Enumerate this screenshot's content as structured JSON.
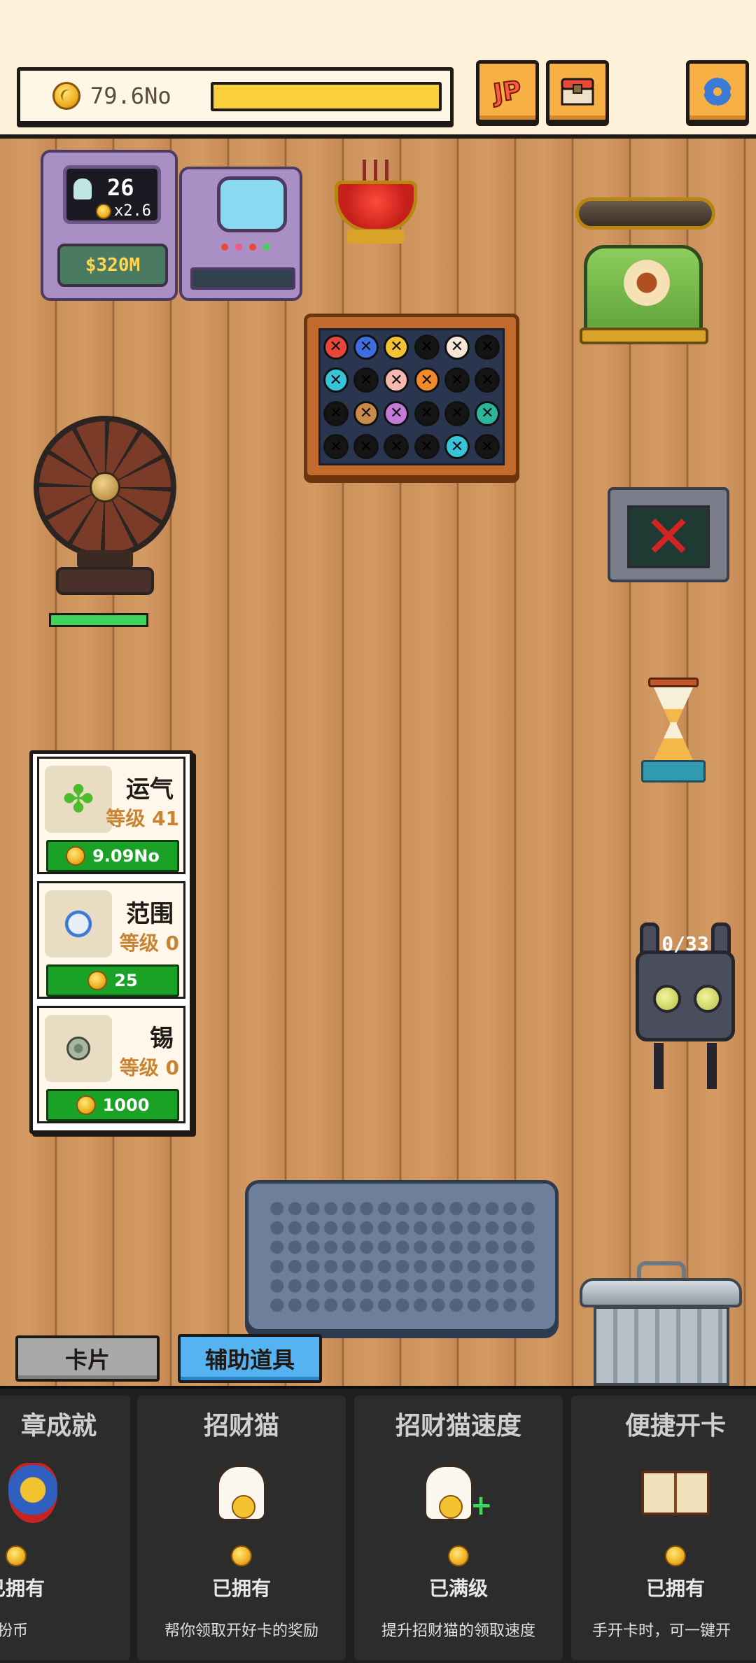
{
  "top_bar": {
    "coins": "79.6No",
    "progress": 1.0,
    "jackpot_label": "JP",
    "buttons": [
      "jackpot-icon",
      "shop-chest-icon",
      "gear-icon"
    ]
  },
  "score_machine": {
    "count": "26",
    "multiplier": "x2.6",
    "money": "$320M"
  },
  "fan": {
    "health": 1.0
  },
  "robot": {
    "counter": "0/33"
  },
  "upgrades": [
    {
      "name": "运气",
      "level": "等级 41",
      "cost": "9.09No",
      "icon": "four-leaf-clover-icon"
    },
    {
      "name": "范围",
      "level": "等级 0",
      "cost": "25",
      "icon": "expand-arrows-icon"
    },
    {
      "name": "锡",
      "level": "等级 0",
      "cost": "1000",
      "icon": "tin-coin-icon"
    }
  ],
  "tabs": {
    "cards": "卡片",
    "tools": "辅助道具"
  },
  "shop_items": [
    {
      "title": "章成就",
      "status": "已拥有",
      "desc": "，领取装扮币",
      "icon": "achievement-badge-icon"
    },
    {
      "title": "招财猫",
      "status": "已拥有",
      "desc": "帮你领取开好卡的奖励",
      "icon": "lucky-cat-icon"
    },
    {
      "title": "招财猫速度",
      "status": "已满级",
      "desc": "提升招财猫的领取速度",
      "icon": "lucky-cat-plus-icon"
    },
    {
      "title": "便捷开卡",
      "status": "已拥有",
      "desc": "手开卡时，可一键开",
      "icon": "spell-book-icon"
    }
  ],
  "bingo_chips": [
    {
      "color": "#e8463a",
      "marked": true
    },
    {
      "color": "#3b6fe0",
      "marked": true
    },
    {
      "color": "#f2c230",
      "marked": true
    },
    {
      "color": "#151515",
      "marked": true
    },
    {
      "color": "#f5e6d8",
      "marked": true
    },
    {
      "color": "#151515",
      "marked": true
    },
    {
      "color": "#38c4d8",
      "marked": true
    },
    {
      "color": "#151515",
      "marked": true
    },
    {
      "color": "#f5b9b0",
      "marked": true
    },
    {
      "color": "#f08a2a",
      "marked": true
    },
    {
      "color": "#151515",
      "marked": true
    },
    {
      "color": "#151515",
      "marked": true
    },
    {
      "color": "#151515",
      "marked": true
    },
    {
      "color": "#c98a4a",
      "marked": true
    },
    {
      "color": "#c47ad8",
      "marked": true
    },
    {
      "color": "#151515",
      "marked": true
    },
    {
      "color": "#151515",
      "marked": true
    },
    {
      "color": "#2bb59a",
      "marked": true
    },
    {
      "color": "#151515",
      "marked": true
    },
    {
      "color": "#151515",
      "marked": true
    },
    {
      "color": "#151515",
      "marked": true
    },
    {
      "color": "#151515",
      "marked": true
    },
    {
      "color": "#38c4d8",
      "marked": true
    },
    {
      "color": "#151515",
      "marked": true
    }
  ],
  "colors": {
    "accent": "#f7b043",
    "progress_fill": "#f9cf3a",
    "upgrade_button": "#1aa226",
    "active_tab": "#56b3f2"
  }
}
